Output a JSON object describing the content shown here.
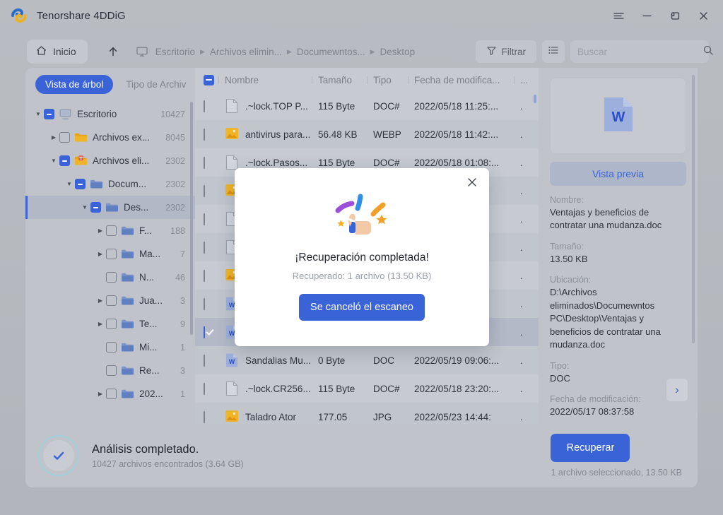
{
  "window": {
    "app_title": "Tenorshare 4DDiG",
    "controls": [
      {
        "name": "menu-icon",
        "label": "≡"
      },
      {
        "name": "minimize-icon",
        "label": "−"
      },
      {
        "name": "maximize-icon",
        "label": "□"
      },
      {
        "name": "close-icon",
        "label": "✕"
      }
    ]
  },
  "toolbar": {
    "home_label": "Inicio",
    "up_label": "↑",
    "breadcrumbs": [
      "Escritorio",
      "Archivos elimin...",
      "Documewntos...",
      "Desktop"
    ],
    "filter_label": "Filtrar",
    "search_placeholder": "Buscar",
    "search_value": ""
  },
  "sidebar": {
    "tabs": [
      {
        "label": "Vista de árbol",
        "active": true
      },
      {
        "label": "Tipo de Archiv",
        "active": false
      }
    ],
    "tree": [
      {
        "indent": 0,
        "caret": "down",
        "check": "partial",
        "icon": "monitor",
        "label": "Escritorio",
        "count": "10427",
        "selected": false
      },
      {
        "indent": 1,
        "caret": "right",
        "check": "empty",
        "icon": "folder-yellow",
        "label": "Archivos ex...",
        "count": "8045",
        "selected": false
      },
      {
        "indent": 1,
        "caret": "down",
        "check": "partial",
        "icon": "folder-trash",
        "label": "Archivos eli...",
        "count": "2302",
        "selected": false
      },
      {
        "indent": 2,
        "caret": "down",
        "check": "partial",
        "icon": "folder-blue",
        "label": "Docum...",
        "count": "2302",
        "selected": false
      },
      {
        "indent": 3,
        "caret": "down",
        "check": "partial",
        "icon": "folder-blue",
        "label": "Des...",
        "count": "2302",
        "selected": true
      },
      {
        "indent": 4,
        "caret": "right",
        "check": "empty",
        "icon": "folder-blue",
        "label": "F...",
        "count": "188",
        "selected": false
      },
      {
        "indent": 4,
        "caret": "right",
        "check": "empty",
        "icon": "folder-blue",
        "label": "Ma...",
        "count": "7",
        "selected": false
      },
      {
        "indent": 4,
        "caret": "none",
        "check": "empty",
        "icon": "folder-blue",
        "label": "N...",
        "count": "46",
        "selected": false
      },
      {
        "indent": 4,
        "caret": "right",
        "check": "empty",
        "icon": "folder-blue",
        "label": "Jua...",
        "count": "3",
        "selected": false
      },
      {
        "indent": 4,
        "caret": "right",
        "check": "empty",
        "icon": "folder-blue",
        "label": "Te...",
        "count": "9",
        "selected": false
      },
      {
        "indent": 4,
        "caret": "none",
        "check": "empty",
        "icon": "folder-blue",
        "label": "Mi...",
        "count": "1",
        "selected": false
      },
      {
        "indent": 4,
        "caret": "none",
        "check": "empty",
        "icon": "folder-blue",
        "label": "Re...",
        "count": "3",
        "selected": false
      },
      {
        "indent": 4,
        "caret": "right",
        "check": "empty",
        "icon": "folder-blue",
        "label": "202...",
        "count": "1",
        "selected": false
      }
    ]
  },
  "filelist": {
    "columns": {
      "name": "Nombre",
      "size": "Tamaño",
      "type": "Tipo",
      "date": "Fecha de modifica...",
      "extra": "..."
    },
    "rows": [
      {
        "checked": false,
        "icon": "file-generic",
        "name": ".~lock.TOP P...",
        "size": "115 Byte",
        "type": "DOC#",
        "date": "2022/05/18 11:25:...",
        "extra": ".",
        "alt": false
      },
      {
        "checked": false,
        "icon": "image-webp",
        "name": "antivirus para...",
        "size": "56.48 KB",
        "type": "WEBP",
        "date": "2022/05/18 11:42:...",
        "extra": ".",
        "alt": true
      },
      {
        "checked": false,
        "icon": "file-generic",
        "name": ".~lock.Pasos...",
        "size": "115 Byte",
        "type": "DOC#",
        "date": "2022/05/18 01:08:...",
        "extra": ".",
        "alt": false
      },
      {
        "checked": false,
        "icon": "image-webp",
        "name": "",
        "size": "",
        "type": "",
        "date": "43:...",
        "extra": ".",
        "alt": true
      },
      {
        "checked": false,
        "icon": "file-generic",
        "name": "",
        "size": "",
        "type": "",
        "date": "01:...",
        "extra": ".",
        "alt": false
      },
      {
        "checked": false,
        "icon": "file-generic",
        "name": "",
        "size": "",
        "type": "",
        "date": "55:...",
        "extra": ".",
        "alt": true
      },
      {
        "checked": false,
        "icon": "image-webp",
        "name": "",
        "size": "",
        "type": "",
        "date": "21:...",
        "extra": ".",
        "alt": false
      },
      {
        "checked": false,
        "icon": "word-doc",
        "name": "",
        "size": "",
        "type": "",
        "date": "21:...",
        "extra": ".",
        "alt": true
      },
      {
        "checked": true,
        "icon": "word-doc",
        "name": "",
        "size": "",
        "type": "",
        "date": "37:...",
        "extra": ".",
        "alt": false,
        "selected": true
      },
      {
        "checked": false,
        "icon": "word-doc",
        "name": "Sandalias Mu...",
        "size": "0 Byte",
        "type": "DOC",
        "date": "2022/05/19 09:06:...",
        "extra": ".",
        "alt": true
      },
      {
        "checked": false,
        "icon": "file-generic",
        "name": ".~lock.CR256...",
        "size": "115 Byte",
        "type": "DOC#",
        "date": "2022/05/18 23:20:...",
        "extra": ".",
        "alt": false
      },
      {
        "checked": false,
        "icon": "image-jpg",
        "name": "Taladro Ator",
        "size": "177.05",
        "type": "JPG",
        "date": "2022/05/23 14:44:",
        "extra": ".",
        "alt": true
      }
    ]
  },
  "preview": {
    "thumb_icon": "word-doc",
    "preview_button": "Vista previa",
    "fields": [
      {
        "key": "Nombre:",
        "value": "Ventajas y beneficios de contratar una mudanza.doc"
      },
      {
        "key": "Tamaño:",
        "value": "13.50 KB"
      },
      {
        "key": "Ubicación:",
        "value": "D:\\Archivos eliminados\\Documewntos PC\\Desktop\\Ventajas y beneficios de contratar una mudanza.doc"
      },
      {
        "key": "Tipo:",
        "value": "DOC"
      },
      {
        "key": "Fecha de modificación:",
        "value": "2022/05/17 08:37:58"
      }
    ],
    "next_label": "›"
  },
  "bottom": {
    "status_title": "Análisis completado.",
    "status_sub": "10427 archivos encontrados (3.64 GB)",
    "recover_label": "Recuperar",
    "selection_info": "1 archivo seleccionado, 13.50 KB"
  },
  "modal": {
    "title": "¡Recuperación completada!",
    "subtitle": "Recuperado: 1 archivo (13.50 KB)",
    "button_label": "Se canceló el escaneo",
    "close_label": "✕"
  },
  "colors": {
    "accent": "#3a63d8",
    "window_bg": "#b9bdc2",
    "panel_bg": "#c0c4ca",
    "list_bg": "#c7cbd1"
  }
}
